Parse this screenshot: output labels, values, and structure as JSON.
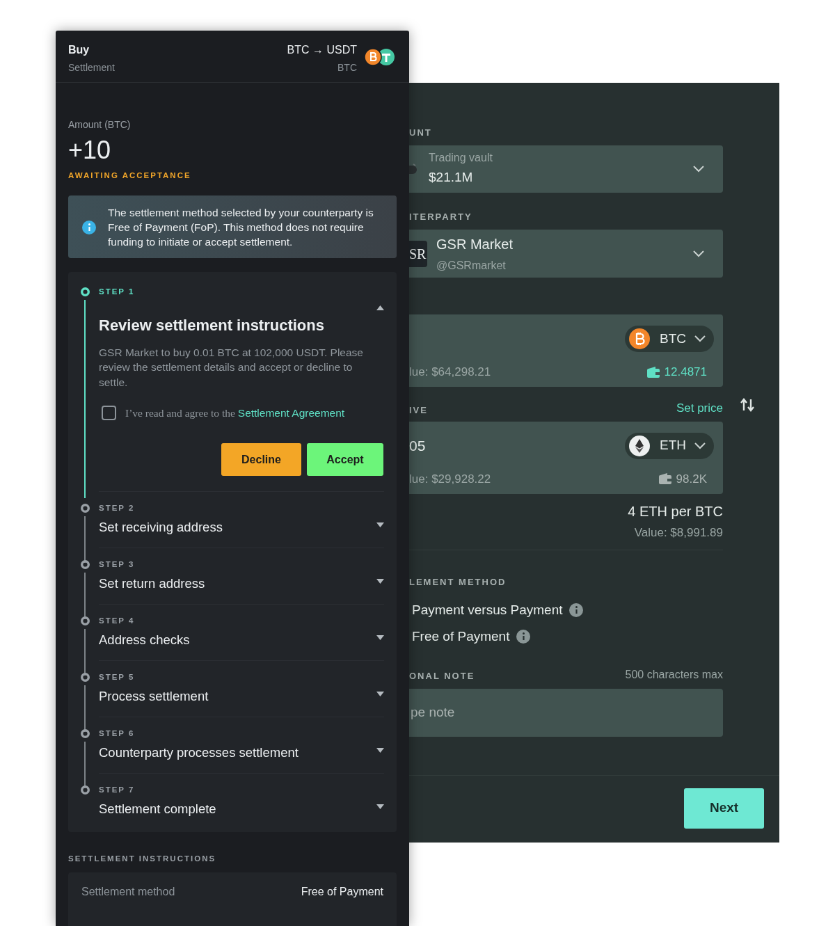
{
  "trade_form": {
    "account": {
      "label": "UNT",
      "name": "Trading vault",
      "balance": "$21.1M"
    },
    "counterparty": {
      "label": "ITERPARTY",
      "logo": "SR",
      "name": "GSR Market",
      "handle": "@GSRmarket"
    },
    "pay": {
      "currency": "BTC",
      "value": "lue: $64,298.21",
      "balance": "12.4871",
      "balance_highlight": true
    },
    "receive": {
      "label": "IVE",
      "link": "Set price",
      "amount": "05",
      "currency": "ETH",
      "value": "lue: $29,928.22",
      "balance": "98.2K",
      "balance_highlight": false
    },
    "rate": {
      "price": "4 ETH per BTC",
      "value": "Value: $8,991.89"
    },
    "settlement_method": {
      "label": "LEMENT METHOD",
      "options": [
        {
          "label": "Payment versus Payment"
        },
        {
          "label": "Free of Payment"
        }
      ]
    },
    "note": {
      "label": "ONAL NOTE",
      "limit": "500 characters max",
      "placeholder": "pe note"
    },
    "next_button": "Next"
  },
  "order_panel": {
    "header": {
      "side": "Buy",
      "subtitle": "Settlement",
      "pair": "BTC → USDT",
      "unit": "BTC"
    },
    "amount_label": "Amount (BTC)",
    "amount": "+10",
    "status": "AWAITING ACCEPTANCE",
    "notice": "The settlement method selected by your counterparty is Free of Payment (FoP). This method does not require funding to initiate or accept settlement.",
    "steps": [
      {
        "label": "STEP 1",
        "title": "Review settlement instructions",
        "active": true,
        "expanded": true,
        "description": "GSR Market to buy 0.01 BTC at 102,000 USDT. Please review the settlement details and accept or decline to settle.",
        "agreement": {
          "text": "I’ve read and agree to the ",
          "link": "Settlement Agreement",
          "checked": false
        },
        "buttons": [
          {
            "label": "Decline",
            "kind": "decline"
          },
          {
            "label": "Accept",
            "kind": "accept"
          }
        ]
      },
      {
        "label": "STEP 2",
        "title": "Set receiving address",
        "active": false,
        "expanded": false
      },
      {
        "label": "STEP 3",
        "title": "Set return address",
        "active": false,
        "expanded": false
      },
      {
        "label": "STEP 4",
        "title": "Address checks",
        "active": false,
        "expanded": false
      },
      {
        "label": "STEP 5",
        "title": "Process settlement",
        "active": false,
        "expanded": false
      },
      {
        "label": "STEP 6",
        "title": "Counterparty processes settlement",
        "active": false,
        "expanded": false
      },
      {
        "label": "STEP 7",
        "title": "Settlement complete",
        "active": false,
        "expanded": false
      }
    ],
    "instructions": {
      "title": "SETTLEMENT INSTRUCTIONS",
      "rows": [
        {
          "label": "Settlement method",
          "value": "Free of Payment"
        }
      ]
    }
  }
}
